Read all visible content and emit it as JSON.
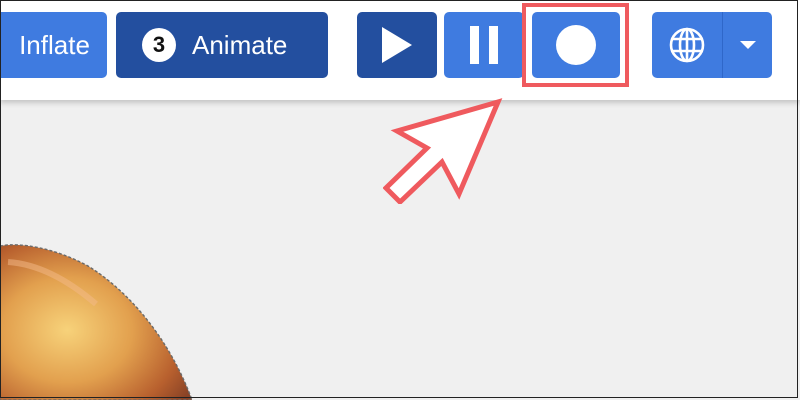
{
  "toolbar": {
    "inflate_label": "Inflate",
    "animate_badge": "3",
    "animate_label": "Animate",
    "play_icon": "play-icon",
    "pause_icon": "pause-icon",
    "record_icon": "record-icon",
    "language_icon": "globe-icon",
    "dropdown_icon": "caret-down-icon"
  },
  "colors": {
    "button_primary": "#3f7be0",
    "button_dark": "#234f9f",
    "highlight": "#ef5a5e",
    "canvas_bg": "#f0f0f0"
  }
}
